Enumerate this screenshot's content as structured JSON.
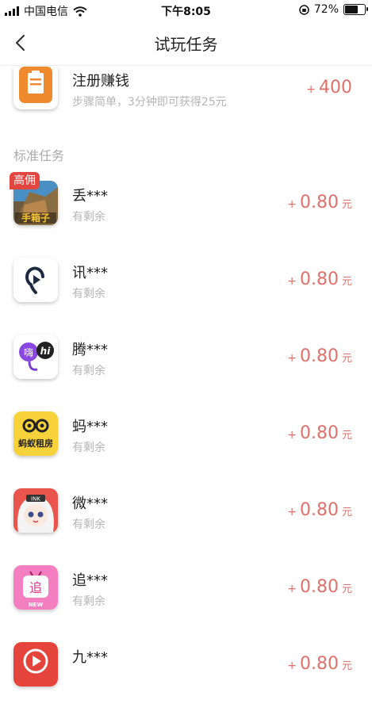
{
  "status_bar": {
    "carrier": "中国电信",
    "time": "下午8:05",
    "battery": "72%",
    "battery_level": 0.72
  },
  "header": {
    "title": "试玩任务"
  },
  "featured_task": {
    "title": "注册赚钱",
    "subtitle": "步骤简单，3分钟即可获得25元",
    "plus": "+",
    "reward": "400"
  },
  "section": {
    "title": "标准任务"
  },
  "tasks": [
    {
      "name": "丢***",
      "status": "有剩余",
      "plus": "+",
      "reward": "0.80",
      "unit": "元",
      "tag": "高佣",
      "icon": "game-app-icon"
    },
    {
      "name": "讯***",
      "status": "有剩余",
      "plus": "+",
      "reward": "0.80",
      "unit": "元",
      "icon": "ear-app-icon"
    },
    {
      "name": "腾***",
      "status": "有剩余",
      "plus": "+",
      "reward": "0.80",
      "unit": "元",
      "icon": "chat-app-icon",
      "icon_text": [
        "嗨",
        "hi"
      ]
    },
    {
      "name": "蚂***",
      "status": "有剩余",
      "plus": "+",
      "reward": "0.80",
      "unit": "元",
      "icon": "ant-rental-app-icon",
      "icon_text": "蚂蚁租房"
    },
    {
      "name": "微***",
      "status": "有剩余",
      "plus": "+",
      "reward": "0.80",
      "unit": "元",
      "icon": "anime-app-icon",
      "icon_text": "INK"
    },
    {
      "name": "追***",
      "status": "有剩余",
      "plus": "+",
      "reward": "0.80",
      "unit": "元",
      "icon": "tv-app-icon",
      "icon_text": [
        "追",
        "NEW"
      ]
    },
    {
      "name": "九***",
      "status": "",
      "plus": "+",
      "reward": "0.80",
      "unit": "元",
      "icon": "play-app-icon"
    }
  ],
  "colors": {
    "reward": "#e0706a",
    "tag": "#e2463e",
    "subtitle": "#b5b5b5"
  }
}
